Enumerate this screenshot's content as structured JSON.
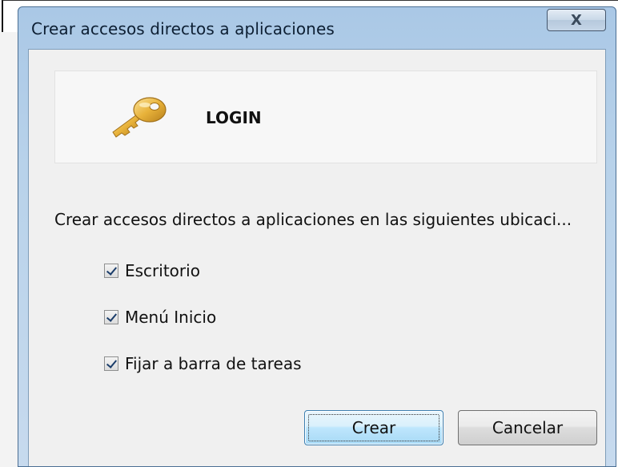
{
  "window": {
    "title": "Crear accesos directos a aplicaciones",
    "close_glyph": "X"
  },
  "app": {
    "name": "LOGIN",
    "icon": "key-icon"
  },
  "instruction": "Crear accesos directos a aplicaciones en las siguientes ubicaci...",
  "options": [
    {
      "label": "Escritorio",
      "checked": true
    },
    {
      "label": "Menú Inicio",
      "checked": true
    },
    {
      "label": "Fijar a barra de tareas",
      "checked": true
    }
  ],
  "buttons": {
    "create_label": "Crear",
    "cancel_label": "Cancelar"
  },
  "colors": {
    "titlebar": "#b8d2ea",
    "client_bg": "#f0f0f0",
    "default_button": "#bee6fd",
    "key_gold": "#e8b23a"
  }
}
